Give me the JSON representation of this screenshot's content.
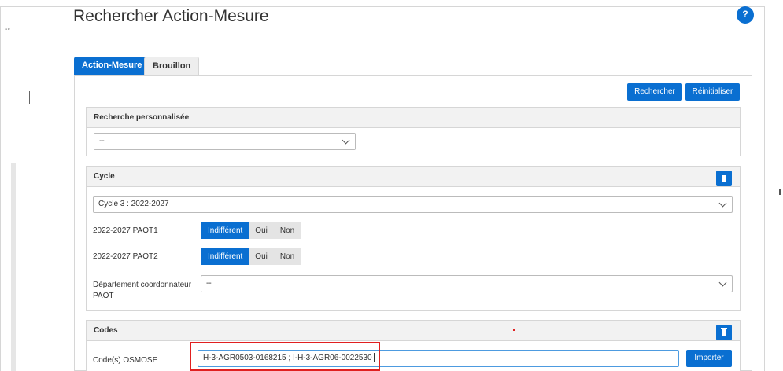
{
  "page": {
    "title": "Rechercher Action-Mesure",
    "help_label": "?"
  },
  "tabs": [
    {
      "label": "Action-Mesure",
      "active": true
    },
    {
      "label": "Brouillon",
      "active": false
    }
  ],
  "toolbar": {
    "search_label": "Rechercher",
    "reset_label": "Réinitialiser"
  },
  "custom_search": {
    "header": "Recherche personnalisée",
    "selected": "--"
  },
  "cycle": {
    "header": "Cycle",
    "selected": "Cycle 3 : 2022-2027",
    "rows": [
      {
        "label": "2022-2027 PAOT1",
        "options": [
          "Indifférent",
          "Oui",
          "Non"
        ],
        "selected": "Indifférent"
      },
      {
        "label": "2022-2027 PAOT2",
        "options": [
          "Indifférent",
          "Oui",
          "Non"
        ],
        "selected": "Indifférent"
      }
    ],
    "dept_label": "Département coordonnateur PAOT",
    "dept_selected": "--"
  },
  "codes": {
    "header": "Codes",
    "osmose_label": "Code(s) OSMOSE",
    "osmose_value": "H-3-AGR0503-0168215 ; I-H-3-AGR06-0022530",
    "import_label": "Importer"
  },
  "colors": {
    "accent": "#0a6fd1",
    "highlight": "#e02020"
  },
  "icons": [
    "pin-icon",
    "crosshair-icon",
    "help-icon",
    "trash-icon",
    "chevron-down-icon"
  ]
}
